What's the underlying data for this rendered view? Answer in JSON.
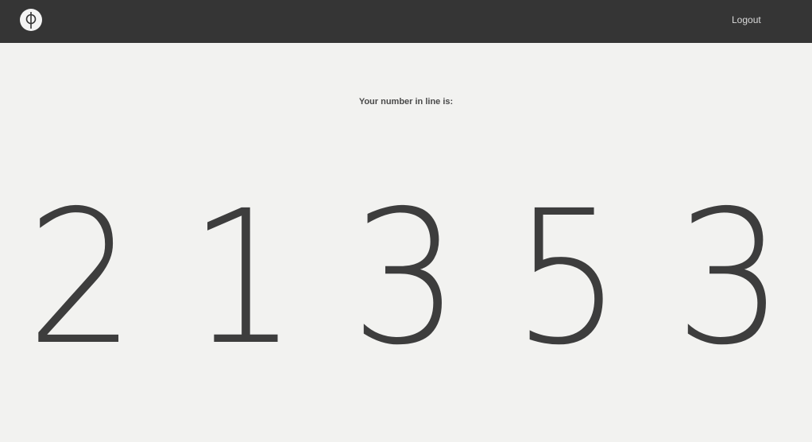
{
  "header": {
    "logo_icon": "phi-circle-logo",
    "logout_label": "Logout"
  },
  "queue": {
    "prompt": "Your number in line is:",
    "digits": [
      "2",
      "1",
      "3",
      "5",
      "3"
    ]
  },
  "colors": {
    "header_bg": "#353535",
    "page_bg": "#f2f2f0",
    "digit_color": "#3d3d3d"
  }
}
